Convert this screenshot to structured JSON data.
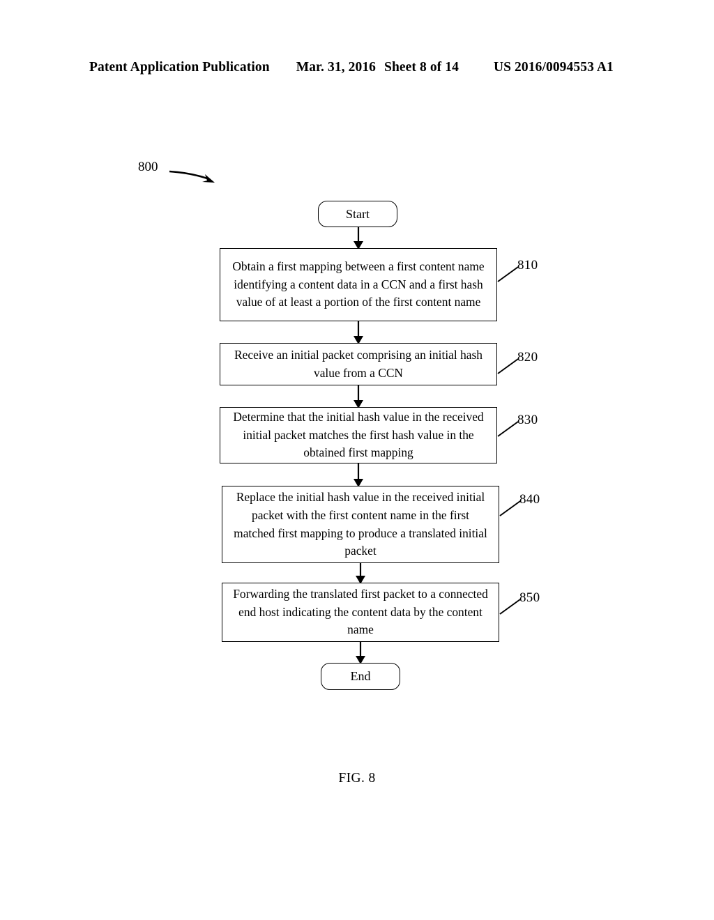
{
  "header": {
    "publication": "Patent Application Publication",
    "date": "Mar. 31, 2016",
    "sheet": "Sheet 8 of 14",
    "patent_number": "US 2016/0094553 A1"
  },
  "figure": {
    "reference_numeral": "800",
    "caption": "FIG. 8"
  },
  "flowchart": {
    "type": "flowchart",
    "orientation": "top-to-bottom",
    "nodes": [
      {
        "id": "start",
        "shape": "rounded-terminal",
        "label": "Start",
        "ref": ""
      },
      {
        "id": "810",
        "shape": "rectangle",
        "label": "Obtain a first mapping between a first content name identifying a content data in a CCN and a first hash value of at least a portion of the first content name",
        "ref": "810"
      },
      {
        "id": "820",
        "shape": "rectangle",
        "label": "Receive an initial packet comprising an initial hash value from a CCN",
        "ref": "820"
      },
      {
        "id": "830",
        "shape": "rectangle",
        "label": "Determine that the initial hash value in the received initial packet matches the first hash value in the obtained first mapping",
        "ref": "830"
      },
      {
        "id": "840",
        "shape": "rectangle",
        "label": "Replace the initial hash value in the received initial packet with the first content name in the first matched first mapping to produce a translated initial packet",
        "ref": "840"
      },
      {
        "id": "850",
        "shape": "rectangle",
        "label": "Forwarding the translated first packet to a connected end host indicating the content data by the content name",
        "ref": "850"
      },
      {
        "id": "end",
        "shape": "rounded-terminal",
        "label": "End",
        "ref": ""
      }
    ],
    "edges": [
      {
        "from": "start",
        "to": "810"
      },
      {
        "from": "810",
        "to": "820"
      },
      {
        "from": "820",
        "to": "830"
      },
      {
        "from": "830",
        "to": "840"
      },
      {
        "from": "840",
        "to": "850"
      },
      {
        "from": "850",
        "to": "end"
      }
    ]
  },
  "colors": {
    "ink": "#000000",
    "paper": "#ffffff"
  }
}
